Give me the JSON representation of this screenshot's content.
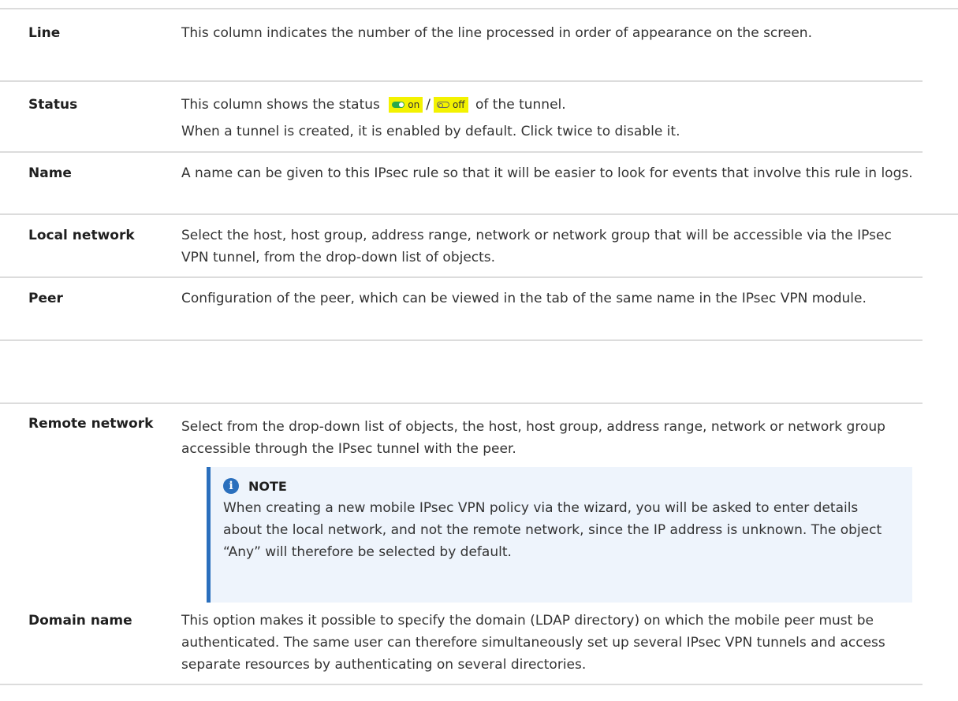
{
  "rows": [
    {
      "label": "Line",
      "lines": [
        "This column indicates the number of the line processed in order of appearance on the screen."
      ]
    },
    {
      "label": "Status",
      "line1_before": "This column shows the status",
      "toggle_on": "on",
      "separator": "/",
      "toggle_off": "off",
      "line1_after": "of the tunnel.",
      "line2": "When a tunnel is created, it is enabled by default. Click twice to disable it."
    },
    {
      "label": "Name",
      "lines": [
        "A name can be given to this IPsec rule so that it will be easier to look for events that involve this rule in logs."
      ]
    },
    {
      "label": "Local network",
      "lines": [
        "Select the host, host group, address range, network or network group that will be accessible via the IPsec VPN tunnel, from the drop-down list of objects."
      ]
    },
    {
      "label": "Peer",
      "lines": [
        "Configuration of the peer, which can be viewed in the tab of the same name in the IPsec VPN module."
      ]
    },
    {
      "label": "Remote network",
      "lines": [
        "Select from the drop-down list of objects, the host, host group, address range, network or network group accessible through the IPsec tunnel with the peer."
      ]
    },
    {
      "label": "Domain name",
      "lines": [
        "This option makes it possible to specify the domain (LDAP directory) on which the mobile peer must be authenticated. The same user can therefore simultaneously set up several IPsec VPN tunnels and access separate resources by authenticating on several directories."
      ]
    }
  ],
  "note": {
    "icon": "info-icon",
    "title": "NOTE",
    "text": "When creating a new mobile IPsec VPN policy via the wizard, you will be asked to enter details about the local network, and not the remote network, since the IP address is unknown. The object “Any” will therefore be selected by default."
  },
  "colors": {
    "toggle_highlight": "#f3f200",
    "toggle_on": "#2aa84a",
    "note_background": "#eef4fc",
    "note_accent": "#2a6fbd",
    "divider": "#dcdcdc"
  }
}
